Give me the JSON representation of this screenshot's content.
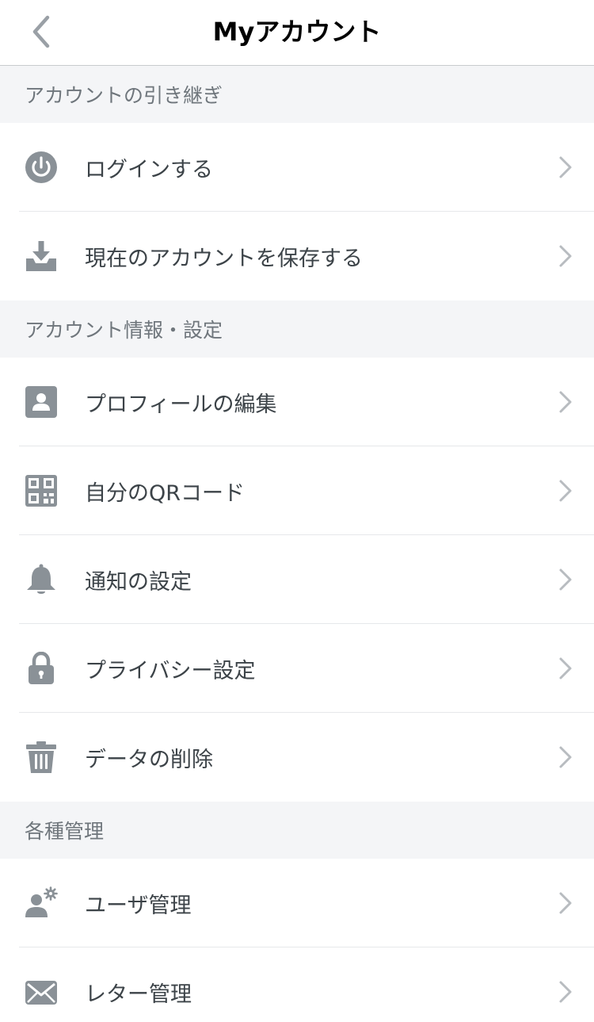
{
  "header": {
    "title": "Myアカウント"
  },
  "sections": [
    {
      "title": "アカウントの引き継ぎ",
      "items": [
        {
          "label": "ログインする",
          "icon": "power-icon"
        },
        {
          "label": "現在のアカウントを保存する",
          "icon": "download-tray-icon"
        }
      ]
    },
    {
      "title": "アカウント情報・設定",
      "items": [
        {
          "label": "プロフィールの編集",
          "icon": "profile-card-icon"
        },
        {
          "label": "自分のQRコード",
          "icon": "qr-code-icon"
        },
        {
          "label": "通知の設定",
          "icon": "bell-icon"
        },
        {
          "label": "プライバシー設定",
          "icon": "lock-icon"
        },
        {
          "label": "データの削除",
          "icon": "trash-icon"
        }
      ]
    },
    {
      "title": "各種管理",
      "items": [
        {
          "label": "ユーザ管理",
          "icon": "user-gear-icon"
        },
        {
          "label": "レター管理",
          "icon": "envelope-icon"
        }
      ]
    }
  ],
  "colors": {
    "icon": "#8a9197",
    "chevron": "#b8bcc0",
    "section_bg": "#f4f5f7"
  }
}
